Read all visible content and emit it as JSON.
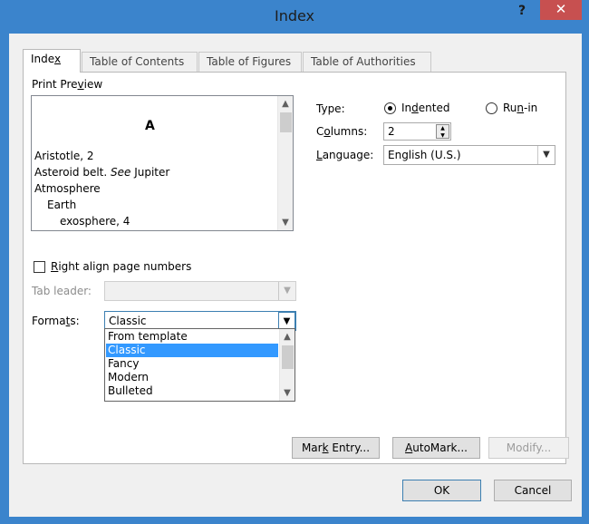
{
  "window": {
    "title": "Index",
    "help_glyph": "?",
    "close_glyph": "✕"
  },
  "tabs": [
    {
      "label": "Index",
      "active": true
    },
    {
      "label": "Table of Contents",
      "active": false
    },
    {
      "label": "Table of Figures",
      "active": false
    },
    {
      "label": "Table of Authorities",
      "active": false
    }
  ],
  "preview": {
    "label": "Print Preview",
    "heading": "A",
    "lines": [
      {
        "text": "Aristotle, 2"
      },
      {
        "text_a": "Asteroid belt. ",
        "text_b": "See",
        "text_c": " Jupiter"
      },
      {
        "text": "Atmosphere"
      },
      {
        "text": "Earth"
      },
      {
        "text": "exosphere, 4"
      }
    ]
  },
  "right_align": {
    "label": "Right align page numbers",
    "checked": false
  },
  "tab_leader": {
    "label": "Tab leader:",
    "value": "",
    "disabled": true
  },
  "formats": {
    "label": "Formats:",
    "value": "Classic",
    "options": [
      "From template",
      "Classic",
      "Fancy",
      "Modern",
      "Bulleted"
    ],
    "selected": "Classic"
  },
  "type": {
    "label": "Type:",
    "options": [
      {
        "label": "Indented",
        "selected": true
      },
      {
        "label": "Run-in",
        "selected": false
      }
    ]
  },
  "columns": {
    "label": "Columns:",
    "value": "2"
  },
  "language": {
    "label": "Language:",
    "value": "English (U.S.)"
  },
  "buttons": {
    "mark_entry": "Mark Entry...",
    "automark": "AutoMark...",
    "modify": "Modify...",
    "ok": "OK",
    "cancel": "Cancel"
  },
  "icons": {
    "scroll_up": "▲",
    "scroll_down": "▼",
    "combo_arrow": "▼"
  }
}
